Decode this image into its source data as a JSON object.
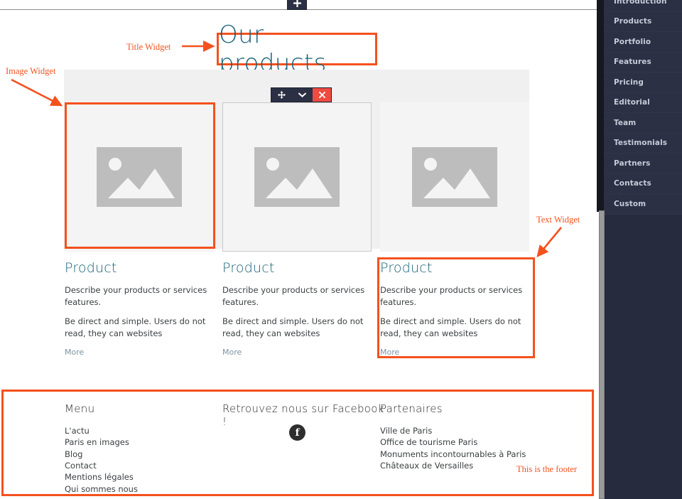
{
  "toolbar": {
    "add_label": "+",
    "add_icon": "plus-icon"
  },
  "widget_toolbar": {
    "move_label": "✛",
    "dropdown_label": "⌄",
    "close_label": "✕"
  },
  "page": {
    "title": "Our products"
  },
  "products": [
    {
      "heading": "Product",
      "para1": "Describe your products or services features.",
      "para2": "Be direct and simple. Users do not read, they can websites",
      "more": "More"
    },
    {
      "heading": "Product",
      "para1": "Describe your products or services features.",
      "para2": "Be direct and simple. Users do not read, they can websites",
      "more": "More"
    },
    {
      "heading": "Product",
      "para1": "Describe your products or services features.",
      "para2": "Be direct and simple. Users do not read, they can websites",
      "more": "More"
    }
  ],
  "footer": {
    "menu": {
      "heading": "Menu",
      "links": [
        "L'actu",
        "Paris en images",
        "Blog",
        "Contact",
        "Mentions légales",
        "Qui sommes nous"
      ]
    },
    "social": {
      "heading": "Retrouvez nous sur Facebook !",
      "icon": "facebook-icon",
      "icon_glyph": "f"
    },
    "partners": {
      "heading": "Partenaires",
      "links": [
        "Ville de Paris",
        "Office de tourisme Paris",
        "Monuments incontournables à Paris",
        "Châteaux de Versailles"
      ]
    }
  },
  "annotations": {
    "title_widget": "Title Widget",
    "image_widget": "Image Widget",
    "text_widget": "Text Widget",
    "footer_note": "This is the footer"
  },
  "sidebar": {
    "items": [
      {
        "label": "Introduction"
      },
      {
        "label": "Products"
      },
      {
        "label": "Portfolio"
      },
      {
        "label": "Features"
      },
      {
        "label": "Pricing"
      },
      {
        "label": "Editorial"
      },
      {
        "label": "Team"
      },
      {
        "label": "Testimonials"
      },
      {
        "label": "Partners"
      },
      {
        "label": "Contacts"
      },
      {
        "label": "Custom"
      }
    ]
  },
  "colors": {
    "accent_orange": "#f4511e",
    "teal": "#1a6278",
    "sidebar_bg": "#262b3d",
    "close_red": "#ef4b41"
  }
}
